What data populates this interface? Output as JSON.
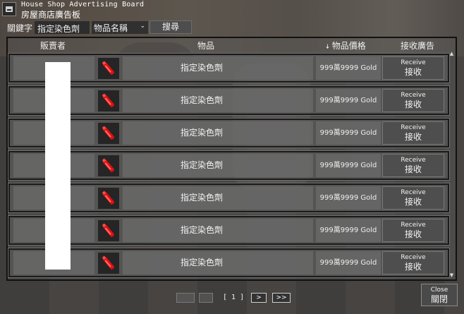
{
  "window": {
    "title_en": "House Shop Advertising Board",
    "title_zh": "房屋商店廣告板"
  },
  "search": {
    "keyword_label": "關鍵字",
    "keyword_value": "指定染色劑",
    "filter_value": "物品名稱",
    "search_label": "搜尋"
  },
  "columns": {
    "seller": "販賣者",
    "item": "物品",
    "price": "物品價格",
    "receive": "接收廣告",
    "sort_icon": "arrow-down-icon"
  },
  "rows": [
    {
      "item": "指定染色劑",
      "price": "999萬9999 Gold",
      "receive_en": "Receive",
      "receive_zh": "接收",
      "icon": "red-dye-icon"
    },
    {
      "item": "指定染色劑",
      "price": "999萬9999 Gold",
      "receive_en": "Receive",
      "receive_zh": "接收",
      "icon": "red-dye-icon"
    },
    {
      "item": "指定染色劑",
      "price": "999萬9999 Gold",
      "receive_en": "Receive",
      "receive_zh": "接收",
      "icon": "red-dye-icon"
    },
    {
      "item": "指定染色劑",
      "price": "999萬9999 Gold",
      "receive_en": "Receive",
      "receive_zh": "接收",
      "icon": "red-dye-icon"
    },
    {
      "item": "指定染色劑",
      "price": "999萬9999 Gold",
      "receive_en": "Receive",
      "receive_zh": "接收",
      "icon": "red-dye-icon"
    },
    {
      "item": "指定染色劑",
      "price": "999萬9999 Gold",
      "receive_en": "Receive",
      "receive_zh": "接收",
      "icon": "red-dye-icon"
    },
    {
      "item": "指定染色劑",
      "price": "999萬9999 Gold",
      "receive_en": "Receive",
      "receive_zh": "接收",
      "icon": "red-dye-icon"
    }
  ],
  "pagination": {
    "current": "[ 1 ]",
    "next_glyph": ">",
    "last_glyph": ">>"
  },
  "close": {
    "en": "Close",
    "zh": "關閉"
  },
  "colors": {
    "item_icon": "#e01010",
    "seller_redaction": "#ffffff"
  }
}
